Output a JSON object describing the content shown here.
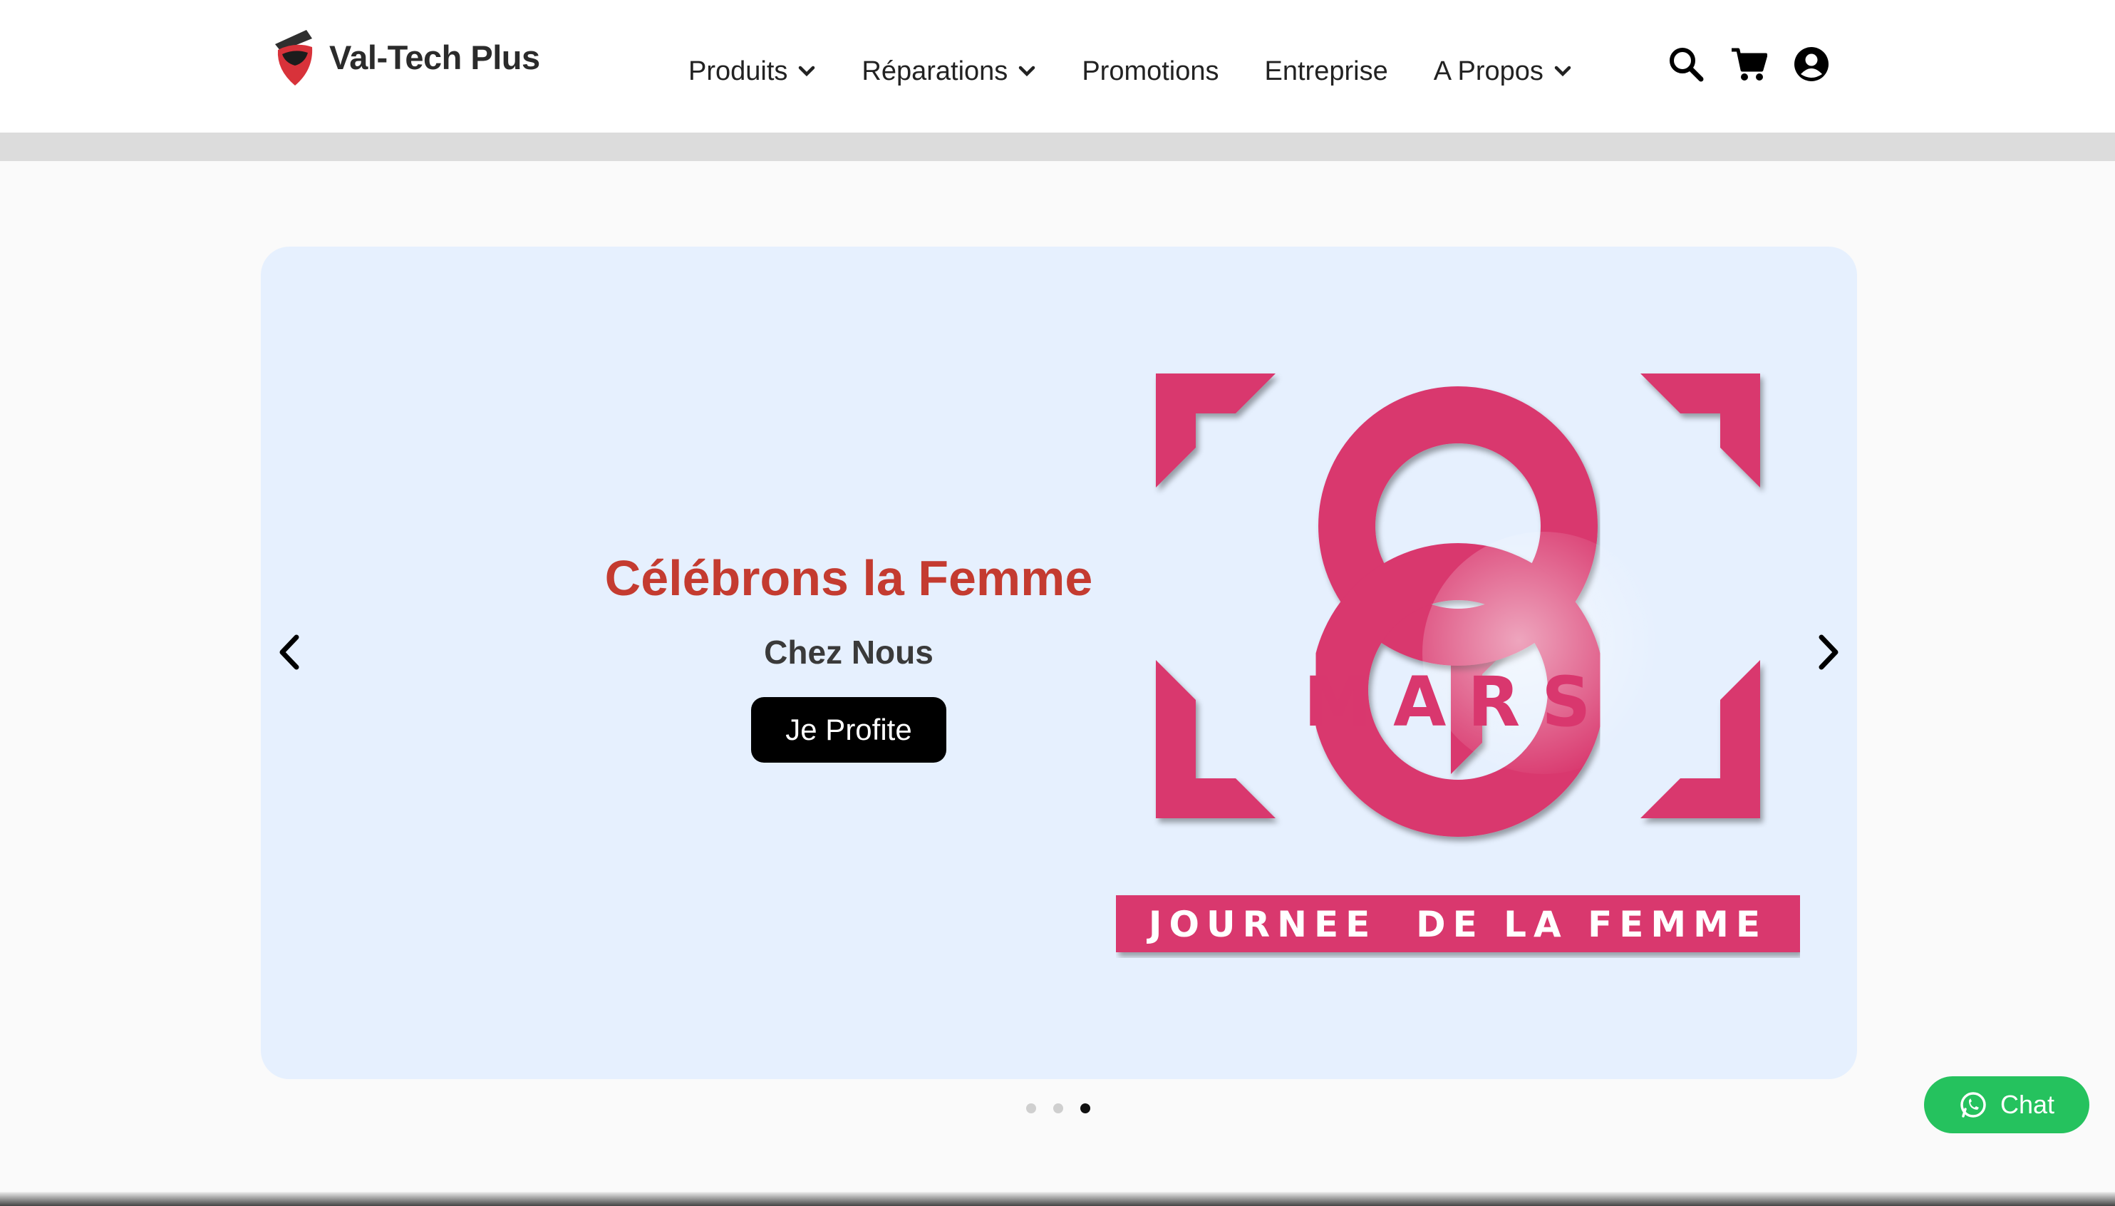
{
  "brand": {
    "name": "Val-Tech Plus"
  },
  "nav": [
    {
      "label": "Produits",
      "dropdown": true
    },
    {
      "label": "Réparations",
      "dropdown": true
    },
    {
      "label": "Promotions",
      "dropdown": false
    },
    {
      "label": "Entreprise",
      "dropdown": false
    },
    {
      "label": "A Propos",
      "dropdown": true
    }
  ],
  "header_icons": [
    "search-icon",
    "cart-icon",
    "user-account-icon"
  ],
  "hero": {
    "title": "Célébrons la Femme",
    "subtitle": "Chez Nous",
    "button": "Je Profite",
    "artwork": {
      "number": "8",
      "word": "MARS",
      "banner": "JOURNEE  DE LA FEMME"
    },
    "slides_count": 3,
    "active_slide": 3
  },
  "chat": {
    "label": "Chat"
  },
  "colors": {
    "title_red": "#c43b30",
    "art_pink": "#d9376e",
    "hero_bg": "#e6f0fe",
    "chat_green": "#25c25e"
  }
}
